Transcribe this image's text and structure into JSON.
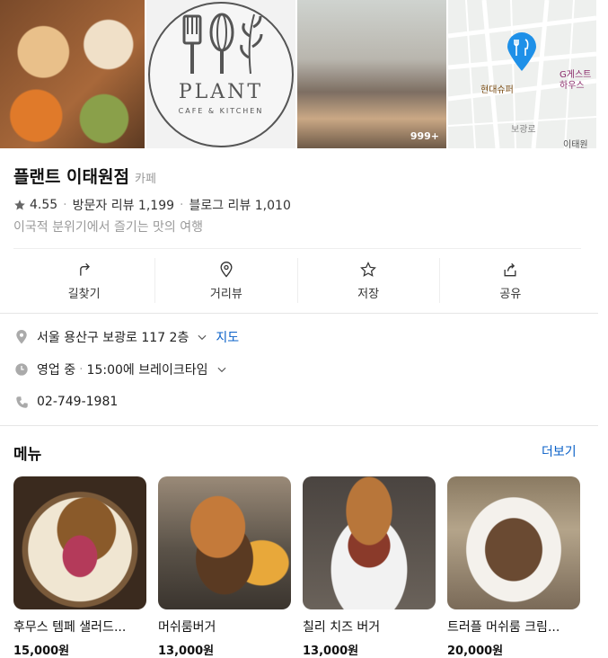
{
  "hero": {
    "logo_word": "PLANT",
    "logo_sub": "CAFE & KITCHEN",
    "photo_count_badge": "999+",
    "map_labels": {
      "store": "현대슈퍼",
      "guesthouse": "G게스트하우스",
      "road_a": "보광로",
      "road_b": "이태원"
    }
  },
  "place": {
    "name": "플랜트 이태원점",
    "category": "카페",
    "rating": "4.55",
    "visitor_reviews": "방문자 리뷰 1,199",
    "blog_reviews": "블로그 리뷰 1,010",
    "tagline": "이국적 분위기에서 즐기는 맛의 여행"
  },
  "actions": [
    {
      "label": "길찾기",
      "icon": "directions-icon"
    },
    {
      "label": "거리뷰",
      "icon": "street-view-icon"
    },
    {
      "label": "저장",
      "icon": "star-icon"
    },
    {
      "label": "공유",
      "icon": "share-icon"
    }
  ],
  "info": {
    "address": "서울 용산구 보광로 117 2층",
    "map_link": "지도",
    "hours_status": "영업 중",
    "hours_detail": "15:00에 브레이크타임",
    "phone": "02-749-1981"
  },
  "menu": {
    "heading": "메뉴",
    "more": "더보기",
    "items": [
      {
        "name": "후무스 템페 샐러드...",
        "price": "15,000원"
      },
      {
        "name": "머쉬룸버거",
        "price": "13,000원"
      },
      {
        "name": "칠리 치즈 버거",
        "price": "13,000원"
      },
      {
        "name": "트러플 머쉬룸 크림...",
        "price": "20,000원"
      }
    ]
  },
  "colors": {
    "link": "#0a60c8",
    "map_pin": "#1e90e8",
    "text_muted": "#999999"
  }
}
